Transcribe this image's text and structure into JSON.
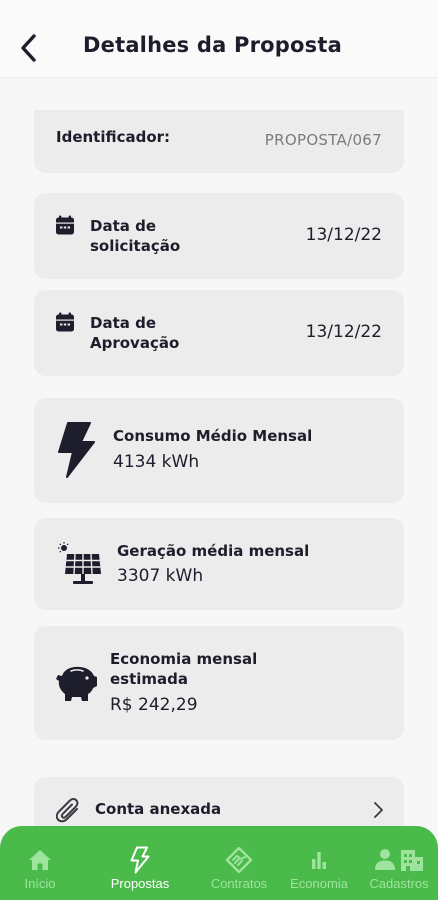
{
  "header": {
    "title": "Detalhes da Proposta",
    "back_icon": "chevron-left-icon"
  },
  "identifier": {
    "label": "Identificador:",
    "value": "PROPOSTA/067"
  },
  "request_date": {
    "label": "Data de solicitação",
    "value": "13/12/22",
    "icon": "calendar-icon"
  },
  "approval_date": {
    "label": "Data de Aprovação",
    "value": "13/12/22",
    "icon": "calendar-icon"
  },
  "consumption": {
    "title": "Consumo Médio Mensal",
    "value": "4134 kWh",
    "icon": "lightning-icon"
  },
  "generation": {
    "title": "Geração média mensal",
    "value": "3307 kWh",
    "icon": "solar-panel-icon"
  },
  "savings": {
    "title": "Economia mensal estimada",
    "value": "R$ 242,29",
    "icon": "piggy-bank-icon"
  },
  "attachment": {
    "label": "Conta anexada",
    "icon": "paperclip-icon",
    "chevron": "chevron-right-icon"
  },
  "nav": {
    "items": [
      {
        "label": "Início",
        "icon": "home-icon",
        "active": false
      },
      {
        "label": "Propostas",
        "icon": "lightning-outline-icon",
        "active": true
      },
      {
        "label": "Contratos",
        "icon": "handshake-icon",
        "active": false
      },
      {
        "label": "Economia",
        "icon": "bar-chart-icon",
        "active": false
      },
      {
        "label": "Cadastros",
        "icon": "user-building-icon",
        "active": false
      }
    ]
  },
  "colors": {
    "nav_background": "#4aba4a",
    "card_background": "#ececec",
    "text_primary": "#1d1d2c",
    "text_muted": "#7b7b80"
  }
}
